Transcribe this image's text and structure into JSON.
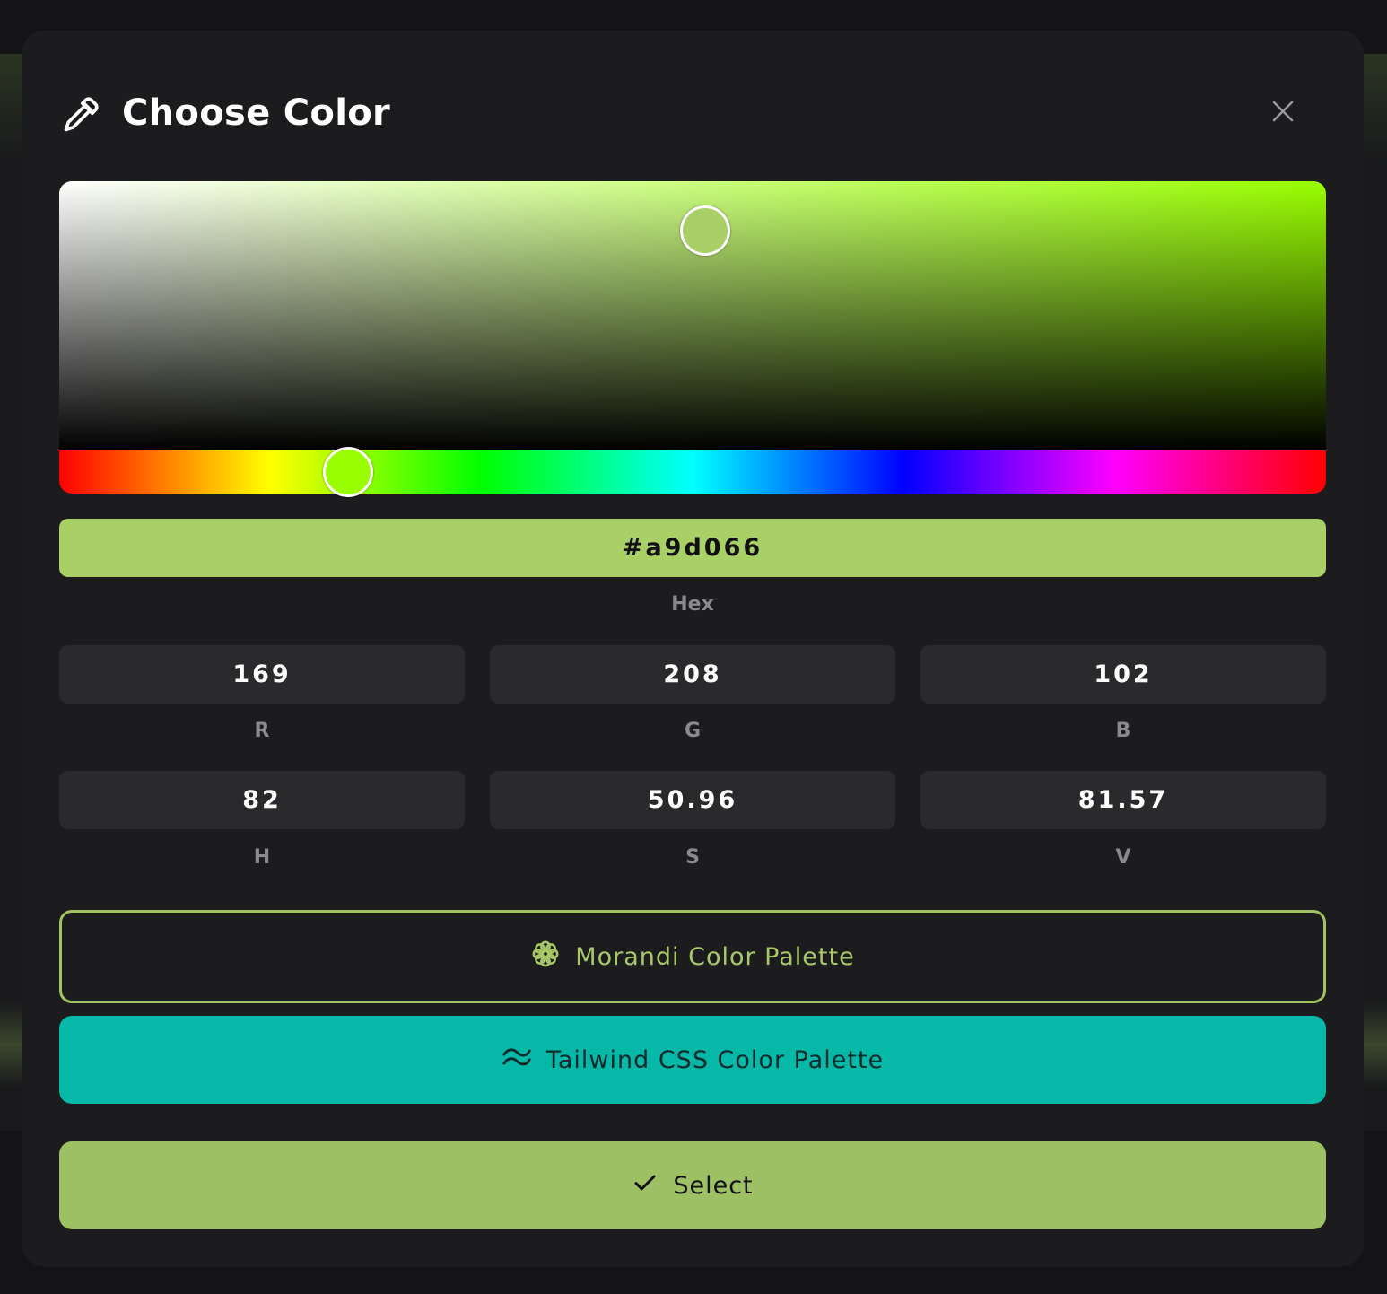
{
  "dialog": {
    "title": "Choose Color",
    "title_icon": "pipette-icon",
    "close_icon": "close-icon"
  },
  "picker": {
    "hue_color": "#99ff00",
    "current_color": "#a9d066",
    "saturation_fraction": 0.5096,
    "value_fraction": 0.8157,
    "hue_fraction": 0.2278
  },
  "hex": {
    "value": "#a9d066",
    "label": "Hex"
  },
  "rgb": [
    {
      "value": "169",
      "label": "R"
    },
    {
      "value": "208",
      "label": "G"
    },
    {
      "value": "102",
      "label": "B"
    }
  ],
  "hsv": [
    {
      "value": "82",
      "label": "H"
    },
    {
      "value": "50.96",
      "label": "S"
    },
    {
      "value": "81.57",
      "label": "V"
    }
  ],
  "buttons": {
    "morandi": {
      "label": "Morandi Color Palette",
      "icon": "flower-icon",
      "color": "#a2c263"
    },
    "tailwind": {
      "label": "Tailwind CSS Color Palette",
      "icon": "tailwind-icon",
      "color": "#05b8a8"
    },
    "select": {
      "label": "Select",
      "icon": "check-icon",
      "color": "#9cc063"
    }
  }
}
